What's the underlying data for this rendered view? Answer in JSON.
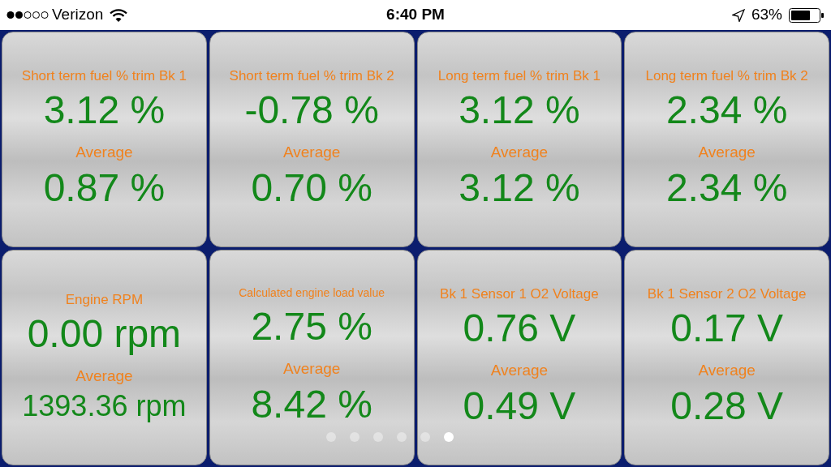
{
  "status_bar": {
    "carrier": "Verizon",
    "time": "6:40 PM",
    "battery": "63%"
  },
  "tiles": [
    {
      "title": "Short term fuel % trim Bk 1",
      "value": "3.12 %",
      "average_label": "Average",
      "average": "0.87 %"
    },
    {
      "title": "Short term fuel % trim Bk 2",
      "value": "-0.78 %",
      "average_label": "Average",
      "average": "0.70 %"
    },
    {
      "title": "Long term fuel % trim Bk 1",
      "value": "3.12 %",
      "average_label": "Average",
      "average": "3.12 %"
    },
    {
      "title": "Long term fuel % trim Bk 2",
      "value": "2.34 %",
      "average_label": "Average",
      "average": "2.34 %"
    },
    {
      "title": "Engine RPM",
      "value": "0.00 rpm",
      "average_label": "Average",
      "average": "1393.36 rpm"
    },
    {
      "title": "Calculated engine load value",
      "value": "2.75 %",
      "average_label": "Average",
      "average": "8.42 %"
    },
    {
      "title": "Bk 1 Sensor 1 O2 Voltage",
      "value": "0.76 V",
      "average_label": "Average",
      "average": "0.49 V"
    },
    {
      "title": "Bk 1 Sensor 2 O2 Voltage",
      "value": "0.17 V",
      "average_label": "Average",
      "average": "0.28 V"
    }
  ],
  "page_dots": [
    {
      "selected": false
    },
    {
      "selected": false
    },
    {
      "selected": false
    },
    {
      "selected": false
    },
    {
      "selected": false
    },
    {
      "selected": true
    }
  ]
}
